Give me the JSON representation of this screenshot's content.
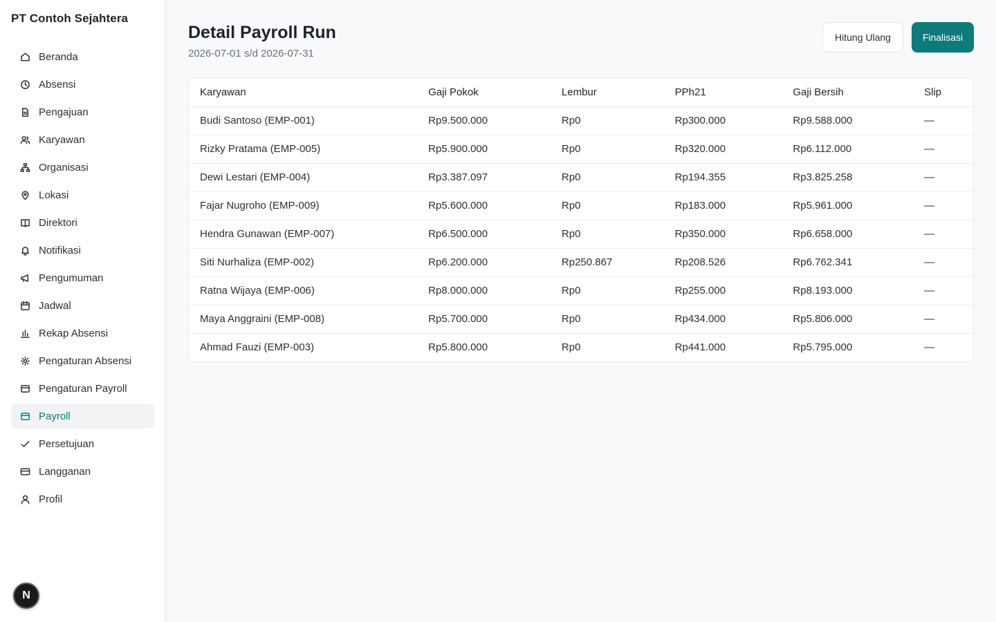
{
  "sidebar": {
    "company": "PT Contoh Sejahtera",
    "items": [
      {
        "label": "Beranda",
        "icon": "home-icon"
      },
      {
        "label": "Absensi",
        "icon": "clock-icon"
      },
      {
        "label": "Pengajuan",
        "icon": "file-icon"
      },
      {
        "label": "Karyawan",
        "icon": "users-icon"
      },
      {
        "label": "Organisasi",
        "icon": "org-chart-icon"
      },
      {
        "label": "Lokasi",
        "icon": "map-pin-icon"
      },
      {
        "label": "Direktori",
        "icon": "book-icon"
      },
      {
        "label": "Notifikasi",
        "icon": "bell-icon"
      },
      {
        "label": "Pengumuman",
        "icon": "megaphone-icon"
      },
      {
        "label": "Jadwal",
        "icon": "calendar-icon"
      },
      {
        "label": "Rekap Absensi",
        "icon": "bar-chart-icon"
      },
      {
        "label": "Pengaturan Absensi",
        "icon": "gear-icon"
      },
      {
        "label": "Pengaturan Payroll",
        "icon": "wallet-icon"
      },
      {
        "label": "Payroll",
        "icon": "wallet-icon",
        "active": true
      },
      {
        "label": "Persetujuan",
        "icon": "check-icon"
      },
      {
        "label": "Langganan",
        "icon": "credit-card-icon"
      },
      {
        "label": "Profil",
        "icon": "user-icon"
      }
    ],
    "badge": "N"
  },
  "header": {
    "title": "Detail Payroll Run",
    "period": "2026-07-01 s/d 2026-07-31"
  },
  "actions": {
    "recalculate": "Hitung Ulang",
    "finalize": "Finalisasi"
  },
  "table": {
    "columns": [
      "Karyawan",
      "Gaji Pokok",
      "Lembur",
      "PPh21",
      "Gaji Bersih",
      "Slip"
    ],
    "rows": [
      [
        "Budi Santoso (EMP-001)",
        "Rp9.500.000",
        "Rp0",
        "Rp300.000",
        "Rp9.588.000",
        "—"
      ],
      [
        "Rizky Pratama (EMP-005)",
        "Rp5.900.000",
        "Rp0",
        "Rp320.000",
        "Rp6.112.000",
        "—"
      ],
      [
        "Dewi Lestari (EMP-004)",
        "Rp3.387.097",
        "Rp0",
        "Rp194.355",
        "Rp3.825.258",
        "—"
      ],
      [
        "Fajar Nugroho (EMP-009)",
        "Rp5.600.000",
        "Rp0",
        "Rp183.000",
        "Rp5.961.000",
        "—"
      ],
      [
        "Hendra Gunawan (EMP-007)",
        "Rp6.500.000",
        "Rp0",
        "Rp350.000",
        "Rp6.658.000",
        "—"
      ],
      [
        "Siti Nurhaliza (EMP-002)",
        "Rp6.200.000",
        "Rp250.867",
        "Rp208.526",
        "Rp6.762.341",
        "—"
      ],
      [
        "Ratna Wijaya (EMP-006)",
        "Rp8.000.000",
        "Rp0",
        "Rp255.000",
        "Rp8.193.000",
        "—"
      ],
      [
        "Maya Anggraini (EMP-008)",
        "Rp5.700.000",
        "Rp0",
        "Rp434.000",
        "Rp5.806.000",
        "—"
      ],
      [
        "Ahmad Fauzi (EMP-003)",
        "Rp5.800.000",
        "Rp0",
        "Rp441.000",
        "Rp5.795.000",
        "—"
      ]
    ]
  },
  "colors": {
    "accent": "#0f7a7a",
    "active_bg": "#f1f3f5"
  }
}
